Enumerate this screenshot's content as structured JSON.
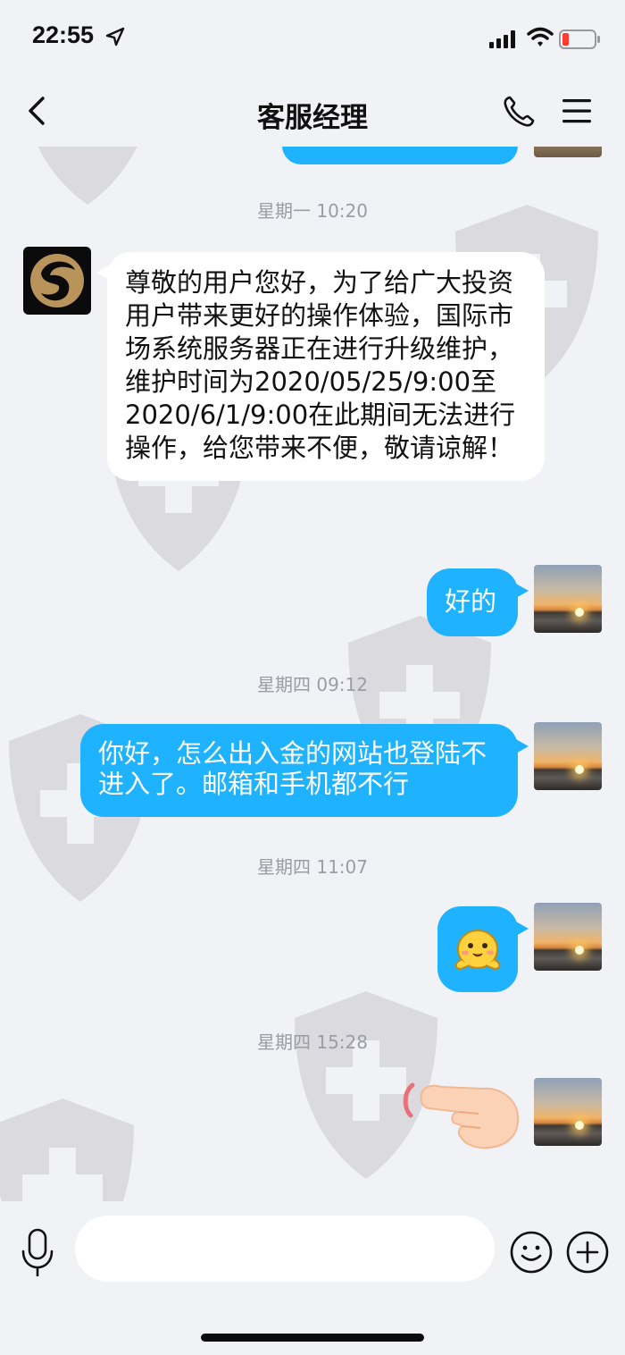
{
  "status_bar": {
    "time": "22:55"
  },
  "header": {
    "title": "客服经理"
  },
  "messages": {
    "ts1": "星期一 10:20",
    "notice": "尊敬的用户您好，为了给广大投资用户带来更好的操作体验，国际市场系统服务器正在进行升级维护，维护时间为2020/05/25/9:00至2020/6/1/9:00在此期间无法进行操作，给您带来不便，敬请谅解！",
    "reply_ok": "好的",
    "ts2": "星期四 09:12",
    "question": "你好，怎么出入金的网站也登陆不进入了。邮箱和手机都不行",
    "ts3": "星期四 11:07",
    "sticker": "emoji-sticker",
    "ts4": "星期四 15:28",
    "poke": "pointing-hand-icon"
  },
  "input": {
    "placeholder": ""
  },
  "colors": {
    "accent": "#1fb3ff",
    "background": "#f1f2f6",
    "bubble_in": "#ffffff"
  }
}
